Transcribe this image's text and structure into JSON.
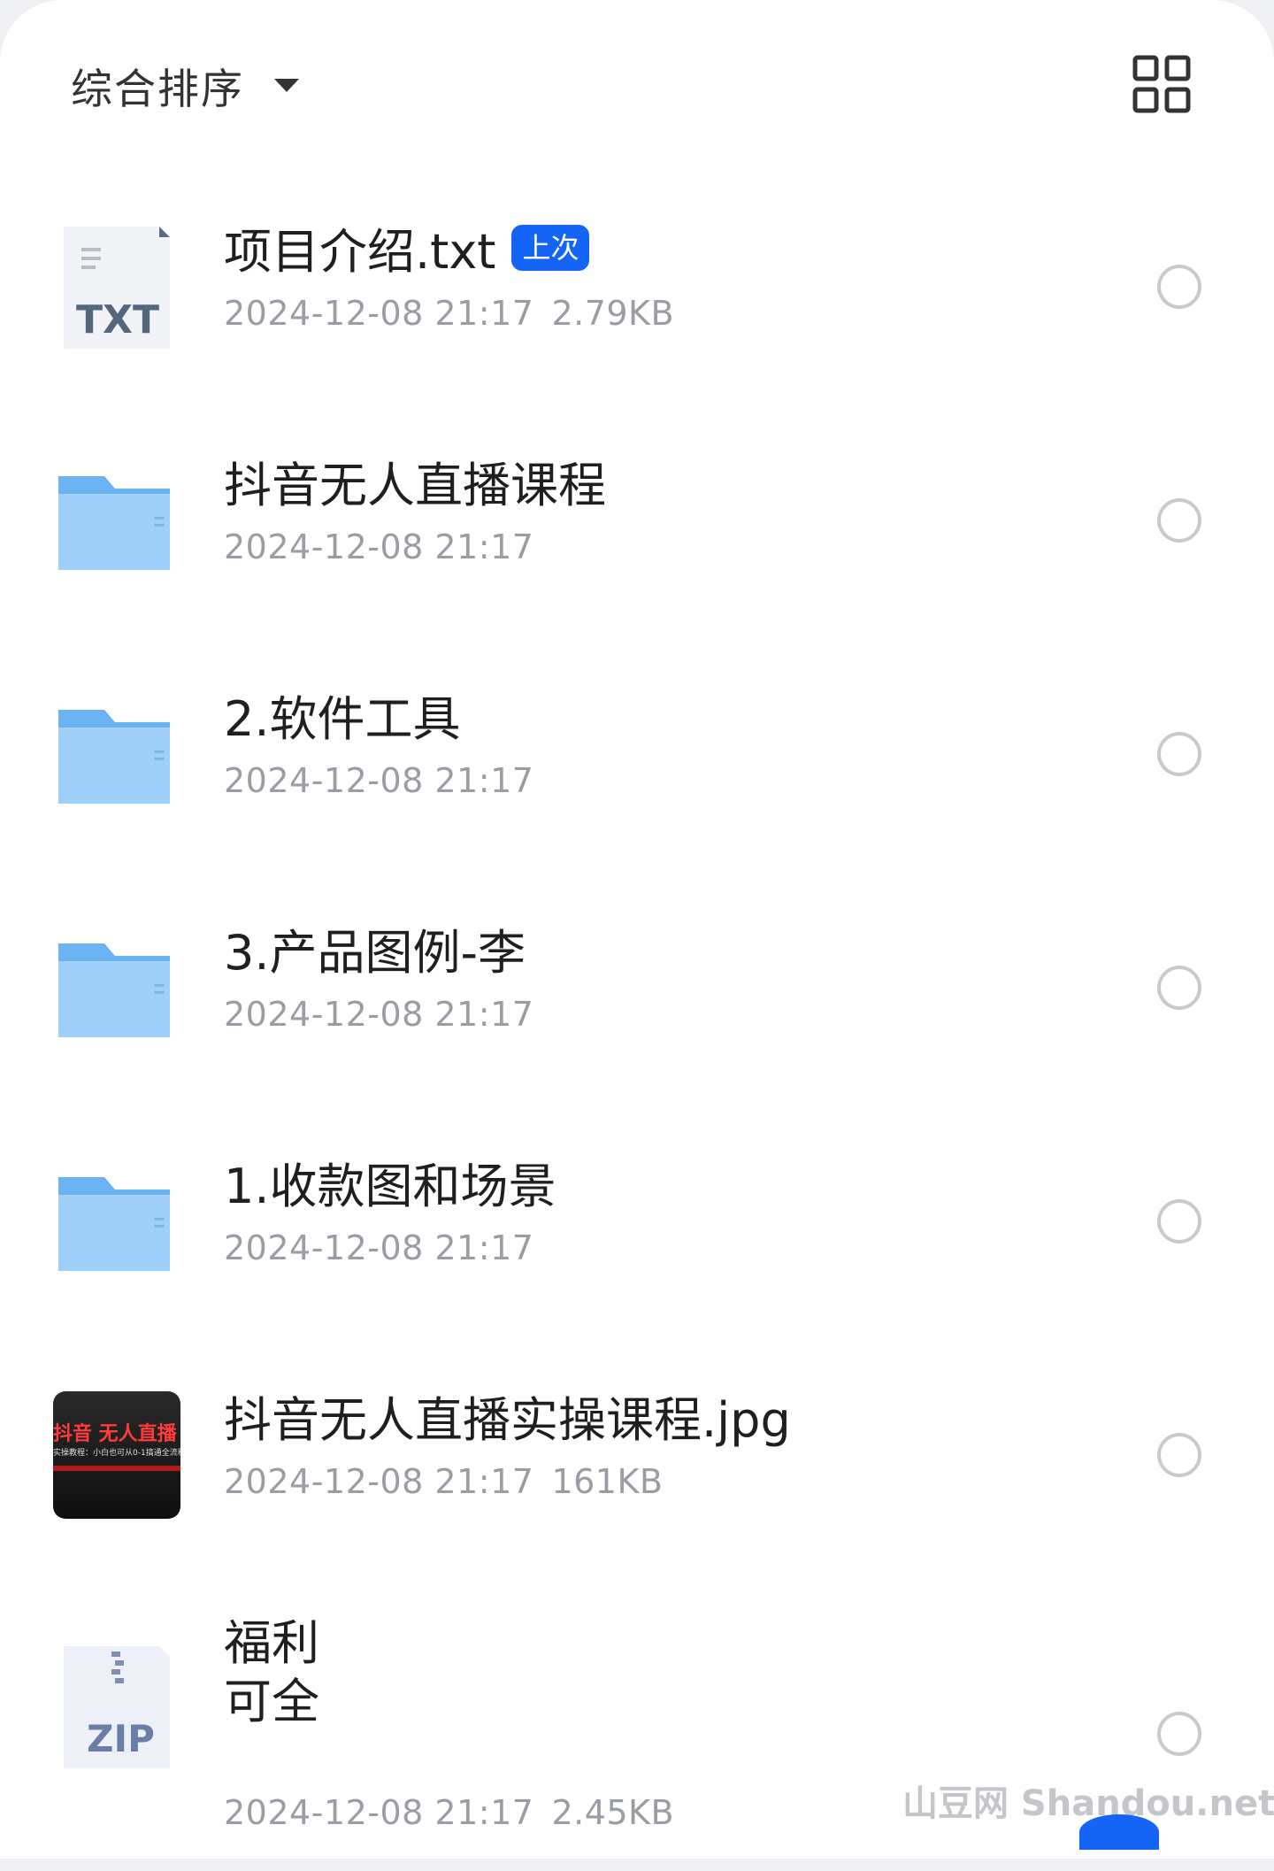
{
  "toolbar": {
    "sort_label": "综合排序",
    "sort_icon": "caret-down-icon",
    "view_icon": "grid-view-icon"
  },
  "files": [
    {
      "name": "项目介绍.txt",
      "badge": "上次",
      "date": "2024-12-08 21:17",
      "size": "2.79KB",
      "type": "txt",
      "type_label": "TXT"
    },
    {
      "name": "抖音无人直播课程",
      "date": "2024-12-08 21:17",
      "size": "",
      "type": "folder"
    },
    {
      "name": "2.软件工具",
      "date": "2024-12-08 21:17",
      "size": "",
      "type": "folder"
    },
    {
      "name": "3.产品图例-李",
      "date": "2024-12-08 21:17",
      "size": "",
      "type": "folder"
    },
    {
      "name": "1.收款图和场景",
      "date": "2024-12-08 21:17",
      "size": "",
      "type": "folder"
    },
    {
      "name": "抖音无人直播实操课程.jpg",
      "date": "2024-12-08 21:17",
      "size": "161KB",
      "type": "image",
      "thumb_text": "抖音 无人直播",
      "thumb_sub": "实操教程：小白也可从0-1搞通全流程"
    },
    {
      "name": "福利",
      "name_line2": "可全",
      "date": "2024-12-08 21:17",
      "size": "2.45KB",
      "type": "zip",
      "type_label": "ZIP"
    }
  ],
  "watermark": "山豆网 Shandou.net",
  "colors": {
    "accent": "#1464f5",
    "folder": "#8ec5f6",
    "meta_text": "#9a9da3"
  }
}
